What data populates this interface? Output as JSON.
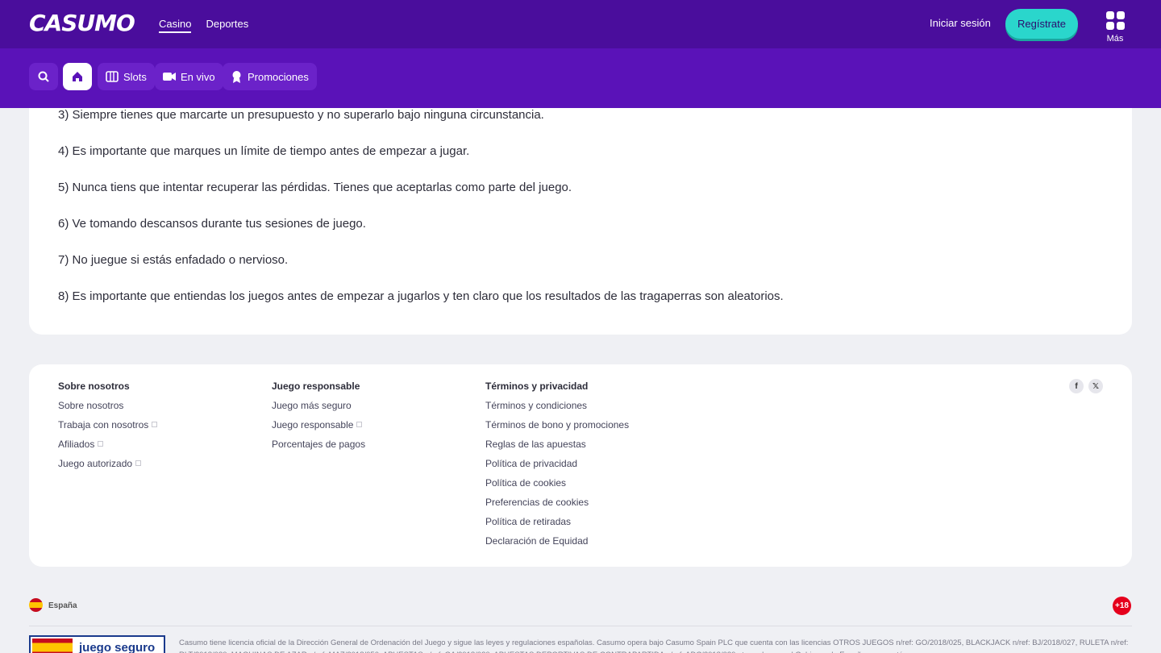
{
  "header": {
    "logo": "CASUMO",
    "nav": [
      "Casino",
      "Deportes"
    ],
    "active_nav": "Casino",
    "login": "Iniciar sesión",
    "register": "Regístrate",
    "more": "Más"
  },
  "subnav": {
    "items": [
      {
        "icon": "search-icon",
        "label": ""
      },
      {
        "icon": "home-icon",
        "label": ""
      },
      {
        "icon": "slots-icon",
        "label": "Slots"
      },
      {
        "icon": "camera-icon",
        "label": "En vivo"
      },
      {
        "icon": "gift-icon",
        "label": "Promociones"
      }
    ]
  },
  "content": {
    "lines": [
      "3) Siempre tienes que marcarte un presupuesto y no superarlo bajo ninguna circunstancia.",
      "4) Es importante que marques un límite de tiempo antes de empezar a jugar.",
      "5) Nunca tiens que intentar recuperar las pérdidas. Tienes que aceptarlas como parte del juego.",
      "6) Ve tomando descansos durante tus sesiones de juego.",
      "7) No juegue si estás enfadado o nervioso.",
      "8) Es importante que entiendas los juegos antes de empezar a jugarlos y ten claro que los resultados de las tragaperras son aleatorios."
    ]
  },
  "footer": {
    "columns": [
      {
        "title": "Sobre nosotros",
        "links": [
          {
            "label": "Sobre nosotros",
            "external": false
          },
          {
            "label": "Trabaja con nosotros",
            "external": true
          },
          {
            "label": "Afiliados",
            "external": true
          },
          {
            "label": "Juego autorizado",
            "external": true
          }
        ]
      },
      {
        "title": "Juego responsable",
        "links": [
          {
            "label": "Juego más seguro",
            "external": false
          },
          {
            "label": "Juego responsable",
            "external": true
          },
          {
            "label": "Porcentajes de pagos",
            "external": false
          }
        ]
      },
      {
        "title": "Términos y privacidad",
        "links": [
          {
            "label": "Términos y condiciones",
            "external": false
          },
          {
            "label": "Términos de bono y promociones",
            "external": false
          },
          {
            "label": "Reglas de las apuestas",
            "external": false
          },
          {
            "label": "Política de privacidad",
            "external": false
          },
          {
            "label": "Política de cookies",
            "external": false
          },
          {
            "label": "Preferencias de cookies",
            "external": false
          },
          {
            "label": "Política de retiradas",
            "external": false
          },
          {
            "label": "Declaración de Equidad",
            "external": false
          }
        ]
      }
    ],
    "social": [
      {
        "icon": "facebook-icon",
        "glyph": "f"
      },
      {
        "icon": "x-icon",
        "glyph": "𝕏"
      }
    ]
  },
  "bottom": {
    "country": "España",
    "age_badge": "+18",
    "badge_text": "juego seguro",
    "legal": "Casumo tiene licencia oficial de la Dirección General de Ordenación del Juego y sigue las leyes y regulaciones españolas. Casumo opera bajo Casumo Spain PLC que cuenta con las licencias OTROS JUEGOS n/ref: GO/2018/025, BLACKJACK n/ref: BJ/2018/027, RULETA n/ref: RLT/2018/030, MAQUINAS DE AZAR n/ref: MAZ/2018/050, APUESTAS n/ref: GA/2018/020, APUESTAS DEPORTIVAS DE CONTRAPARTIDA n/ref: ADC/2018/030 otorgadas por el Gobierno de España y que están"
  },
  "colors": {
    "topbar": "#4a0d9c",
    "subbar": "#5a12b8",
    "accent": "#2ad6cc",
    "background": "#eff0f4"
  }
}
